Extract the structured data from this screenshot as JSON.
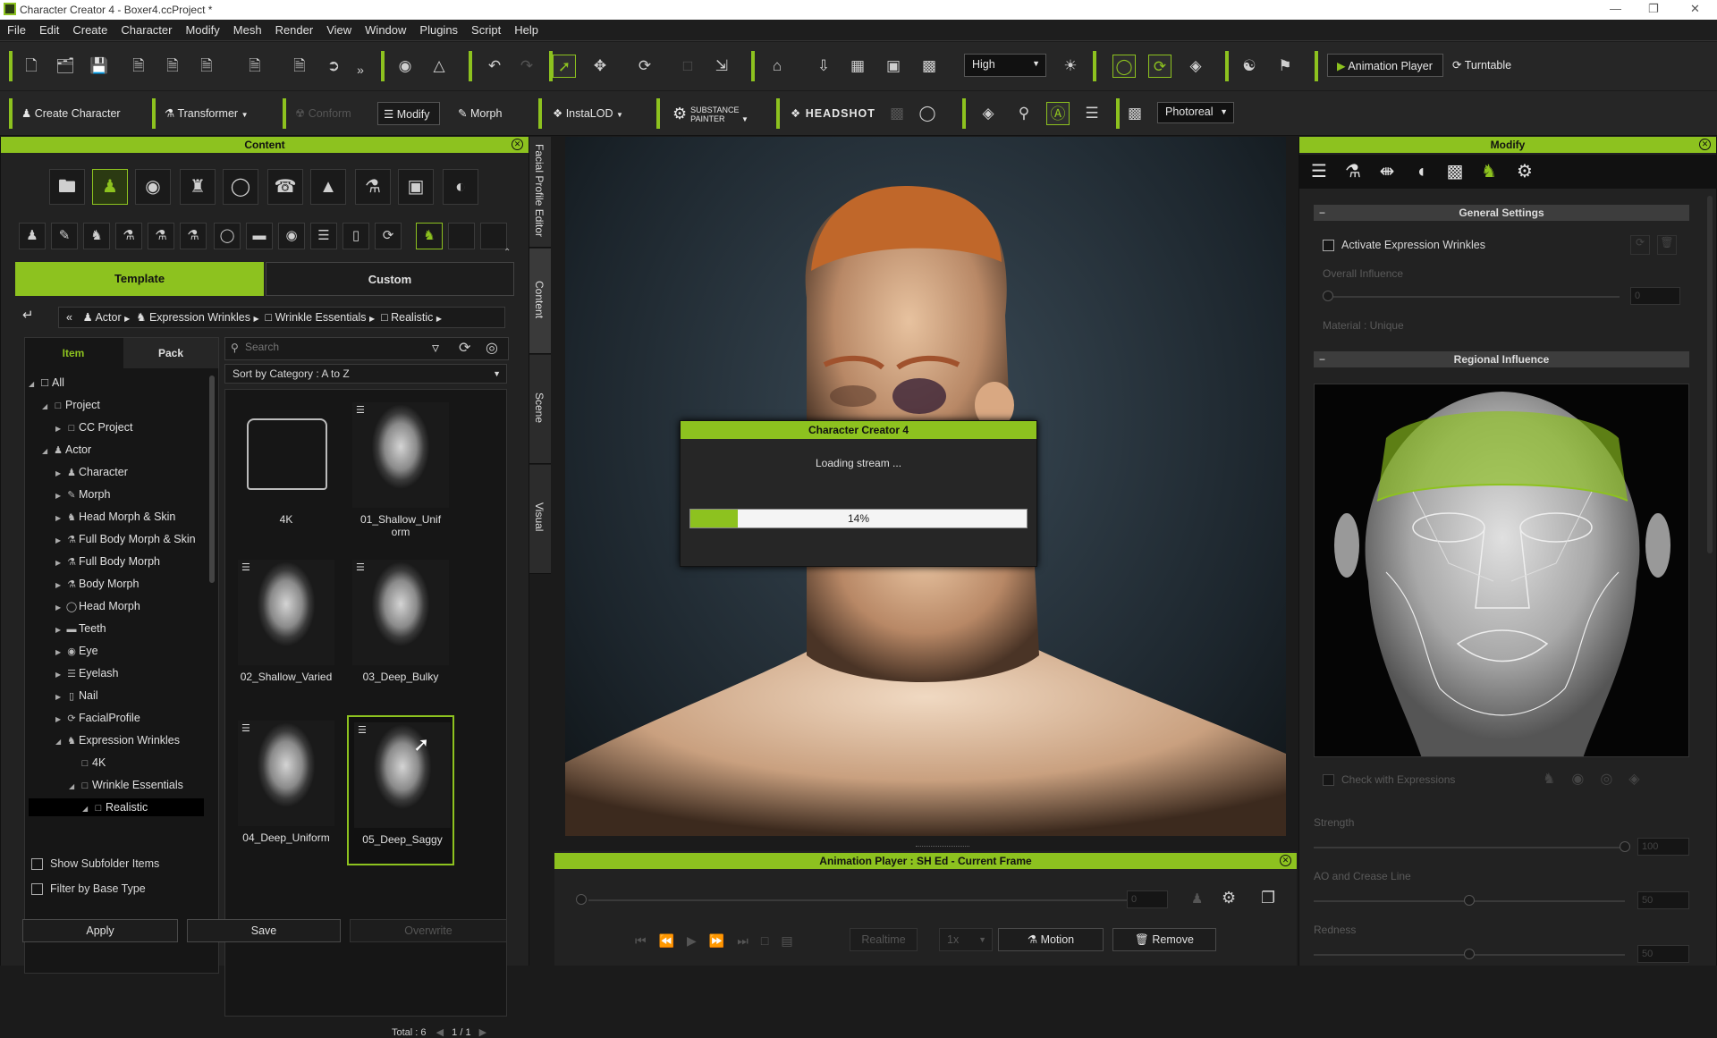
{
  "window": {
    "title": "Character Creator 4 - Boxer4.ccProject *"
  },
  "menu": [
    "File",
    "Edit",
    "Create",
    "Character",
    "Modify",
    "Mesh",
    "Render",
    "View",
    "Window",
    "Plugins",
    "Script",
    "Help"
  ],
  "toolbar1": {
    "quality_select": "High",
    "animation_player_label": "Animation Player",
    "turntable_label": "Turntable"
  },
  "toolbar2": {
    "create_character": "Create Character",
    "transformer": "Transformer",
    "conform": "Conform",
    "modify": "Modify",
    "morph": "Morph",
    "instalod": "InstaLOD",
    "substance_painter": "SUBSTANCE\nPAINTER",
    "headshot": "HEADSHOT",
    "render_select": "Photoreal"
  },
  "content_panel": {
    "title": "Content",
    "tabs": [
      "Template",
      "Custom"
    ],
    "active_tab": "Template",
    "breadcrumb": [
      "Actor",
      "Expression Wrinkles",
      "Wrinkle Essentials",
      "Realistic"
    ],
    "subtabs": [
      "Item",
      "Pack"
    ],
    "search_placeholder": "Search",
    "sort_label": "Sort by Category : A to Z",
    "tree": [
      {
        "label": "All",
        "level": 0,
        "expanded": true
      },
      {
        "label": "Project",
        "level": 1,
        "expanded": true
      },
      {
        "label": "CC Project",
        "level": 2,
        "expanded": false
      },
      {
        "label": "Actor",
        "level": 1,
        "expanded": true
      },
      {
        "label": "Character",
        "level": 2,
        "expanded": false
      },
      {
        "label": "Morph",
        "level": 2,
        "expanded": false
      },
      {
        "label": "Head Morph & Skin",
        "level": 2,
        "expanded": false
      },
      {
        "label": "Full Body Morph & Skin",
        "level": 2,
        "expanded": false
      },
      {
        "label": "Full Body Morph",
        "level": 2,
        "expanded": false
      },
      {
        "label": "Body Morph",
        "level": 2,
        "expanded": false
      },
      {
        "label": "Head Morph",
        "level": 2,
        "expanded": false
      },
      {
        "label": "Teeth",
        "level": 2,
        "expanded": false
      },
      {
        "label": "Eye",
        "level": 2,
        "expanded": false
      },
      {
        "label": "Eyelash",
        "level": 2,
        "expanded": false
      },
      {
        "label": "Nail",
        "level": 2,
        "expanded": false
      },
      {
        "label": "FacialProfile",
        "level": 2,
        "expanded": false
      },
      {
        "label": "Expression Wrinkles",
        "level": 2,
        "expanded": true
      },
      {
        "label": "4K",
        "level": 3,
        "expanded": false
      },
      {
        "label": "Wrinkle Essentials",
        "level": 3,
        "expanded": true
      },
      {
        "label": "Realistic",
        "level": 4,
        "expanded": true,
        "selected": true
      }
    ],
    "items": [
      {
        "label": "4K",
        "type": "folder"
      },
      {
        "label": "01_Shallow_Uniform",
        "type": "face"
      },
      {
        "label": "02_Shallow_Varied",
        "type": "face"
      },
      {
        "label": "03_Deep_Bulky",
        "type": "face"
      },
      {
        "label": "04_Deep_Uniform",
        "type": "face"
      },
      {
        "label": "05_Deep_Saggy",
        "type": "face",
        "selected": true
      }
    ],
    "total_label": "Total : 6",
    "page": "1",
    "page_sep": "/",
    "page_total": "1",
    "show_subfolder": "Show Subfolder Items",
    "filter_base": "Filter by Base Type",
    "apply": "Apply",
    "save": "Save",
    "overwrite": "Overwrite"
  },
  "side_tabs": [
    "Facial Profile Editor",
    "Content",
    "Scene",
    "Visual"
  ],
  "loading_dialog": {
    "title": "Character Creator 4",
    "message": "Loading stream ...",
    "progress": 0.14,
    "progress_label": "14%"
  },
  "animation_player": {
    "title": "Animation Player : SH Ed - Current Frame",
    "frame": "0",
    "realtime": "Realtime",
    "speed": "1x",
    "motion": "Motion",
    "remove": "Remove"
  },
  "modify_panel": {
    "title": "Modify",
    "general_settings": "General Settings",
    "activate_wrinkles": "Activate Expression Wrinkles",
    "overall_influence": "Overall Influence",
    "overall_value": "0",
    "material": "Material : Unique",
    "regional_influence": "Regional Influence",
    "check_expressions": "Check with Expressions",
    "strength": "Strength",
    "strength_value": "100",
    "ao_crease": "AO and Crease Line",
    "ao_value": "50",
    "redness": "Redness",
    "redness_value": "50"
  },
  "colors": {
    "accent": "#8dc21f",
    "panel": "#222222",
    "dark": "#151515"
  }
}
